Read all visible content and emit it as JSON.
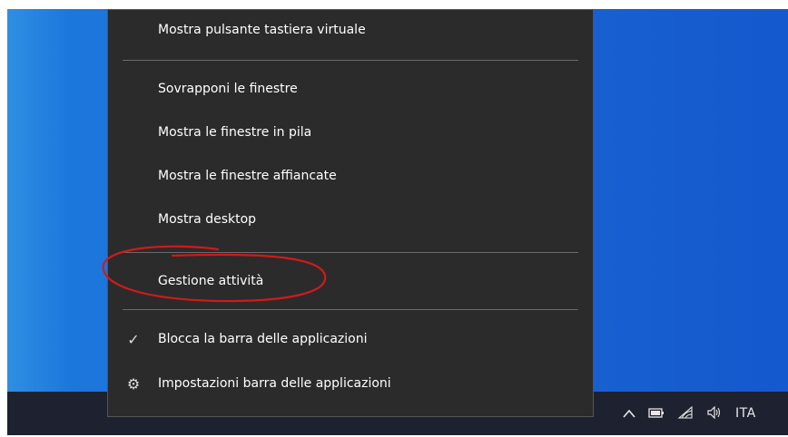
{
  "menu": {
    "items": [
      {
        "label": "Mostra pulsante tastiera virtuale",
        "mark": ""
      },
      {
        "label": "Sovrapponi le finestre",
        "mark": ""
      },
      {
        "label": "Mostra le finestre in pila",
        "mark": ""
      },
      {
        "label": "Mostra le finestre affiancate",
        "mark": ""
      },
      {
        "label": "Mostra desktop",
        "mark": ""
      },
      {
        "label": "Gestione attività",
        "mark": ""
      },
      {
        "label": "Blocca la barra delle applicazioni",
        "mark": "✓"
      },
      {
        "label": "Impostazioni barra delle applicazioni",
        "mark": "⚙"
      }
    ]
  },
  "tray": {
    "chevron": "^",
    "battery_icon": "battery-icon",
    "wifi_icon": "wifi-icon",
    "volume_icon": "volume-icon",
    "language": "ITA"
  },
  "colors": {
    "menu_bg": "#2b2b2b",
    "desktop_blue": "#1a63d3",
    "taskbar": "#1e2230",
    "annotation": "#d21a1a"
  }
}
